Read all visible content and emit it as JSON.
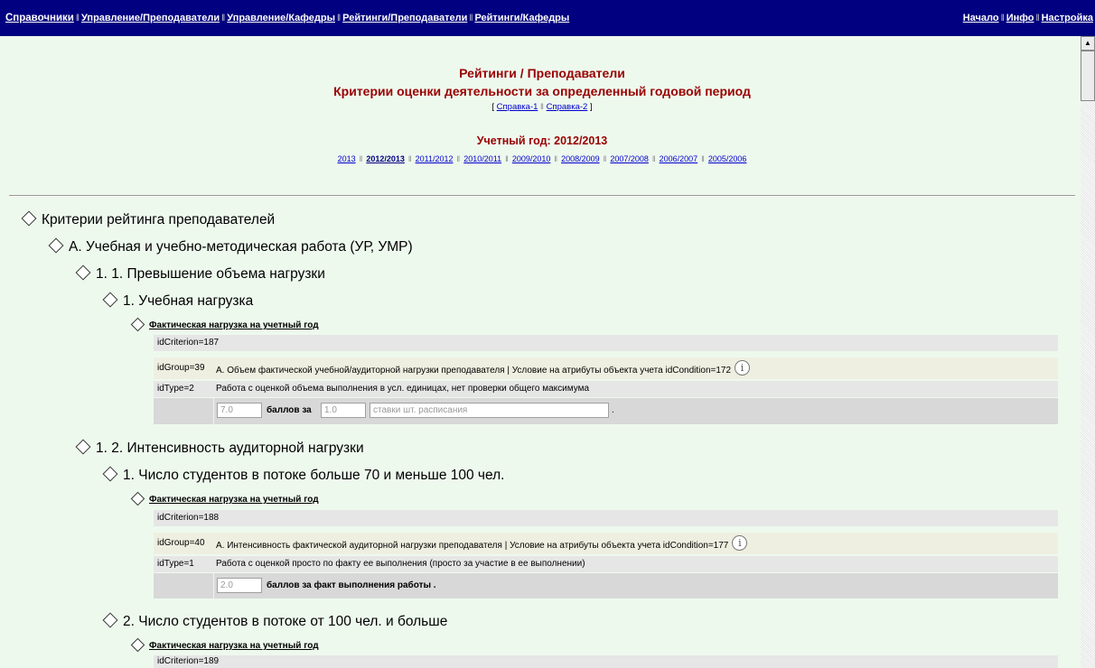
{
  "nav": {
    "left": [
      {
        "main": "Справочники",
        "sub": ""
      },
      {
        "main": "Управление",
        "sub": "/Преподаватели"
      },
      {
        "main": "Управление",
        "sub": "/Кафедры"
      },
      {
        "main": "Рейтинги",
        "sub": "/Преподаватели"
      },
      {
        "main": "Рейтинги",
        "sub": "/Кафедры"
      }
    ],
    "right": [
      "Начало",
      "Инфо",
      "Настройка"
    ]
  },
  "header": {
    "title1": "Рейтинги / Преподаватели",
    "title2": "Критерии оценки деятельности за определенный годовой период",
    "help_open": "[",
    "help1": "Справка-1",
    "help2": "Справка-2",
    "help_close": "]",
    "year_label": "Учетный год: 2012/2013",
    "years": [
      "2013",
      "2012/2013",
      "2011/2012",
      "2010/2011",
      "2009/2010",
      "2008/2009",
      "2007/2008",
      "2006/2007",
      "2005/2006"
    ],
    "current_year": "2012/2013"
  },
  "tree": {
    "root": "Критерии рейтинга преподавателей",
    "sectionA": "А. Учебная и учебно-методическая работа (УР, УМР)",
    "g1": {
      "title": "1. 1. Превышение объема нагрузки",
      "sub1": {
        "title": "1. Учебная нагрузка",
        "criterion": "Фактическая нагрузка на учетный год",
        "idCriterion": "idCriterion=187",
        "idGroup_k": "idGroup=39",
        "idGroup_v": "А. Объем фактической учебной/аудиторной нагрузки преподавателя | Условие на атрибуты объекта учета idCondition=172",
        "idType_k": "idType=2",
        "idType_v": "Работа с оценкой объема выполнения в усл. единицах, нет проверки общего максимума",
        "points": "7.0",
        "points_for": "баллов за",
        "per_value": "1.0",
        "unit": "ставки шт. расписания",
        "dot": "."
      }
    },
    "g2": {
      "title": "1. 2. Интенсивность аудиторной нагрузки",
      "sub1": {
        "title": "1. Число студентов в потоке больше 70 и меньше 100 чел.",
        "criterion": "Фактическая нагрузка на учетный год",
        "idCriterion": "idCriterion=188",
        "idGroup_k": "idGroup=40",
        "idGroup_v": "А. Интенсивность фактической аудиторной нагрузки преподавателя | Условие на атрибуты объекта учета idCondition=177",
        "idType_k": "idType=1",
        "idType_v": "Работа с оценкой просто по факту ее выполнения (просто за участие в ее выполнении)",
        "points": "2.0",
        "points_text": "баллов за факт выполнения работы ."
      },
      "sub2": {
        "title": "2. Число студентов в потоке от 100 чел. и больше",
        "criterion": "Фактическая нагрузка на учетный год",
        "idCriterion": "idCriterion=189"
      }
    }
  },
  "icons": {
    "info": "info-icon",
    "node": "diamond-icon"
  },
  "colors": {
    "nav_bg": "#000080",
    "title_red": "#990000",
    "page_bg": "#eef9ee"
  }
}
